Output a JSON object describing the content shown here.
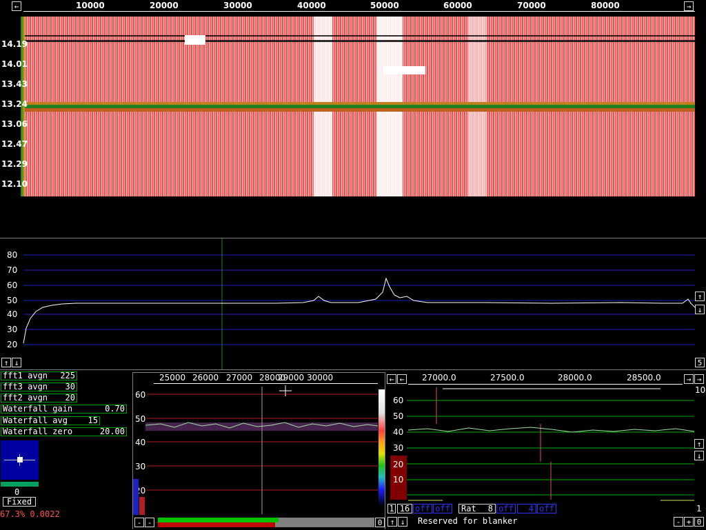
{
  "waterfall": {
    "freq_ticks": [
      "10000",
      "20000",
      "30000",
      "40000",
      "50000",
      "60000",
      "70000",
      "80000"
    ],
    "time_labels": [
      "14.19",
      "14.01",
      "13.43",
      "13.24",
      "13.06",
      "12.47",
      "12.29",
      "12.10"
    ]
  },
  "spectrum": {
    "y_ticks": [
      "80",
      "70",
      "60",
      "50",
      "40",
      "30",
      "20"
    ],
    "right_label": "5"
  },
  "params": [
    {
      "name": "fft1 avgn",
      "value": "225"
    },
    {
      "name": "fft3 avgn",
      "value": "30"
    },
    {
      "name": "fft2 avgn",
      "value": "20"
    },
    {
      "name": "Waterfall gain",
      "value": "0.70"
    },
    {
      "name": "Waterfall avg",
      "value": "15"
    },
    {
      "name": "Waterfall zero",
      "value": "20.00"
    }
  ],
  "smeter": {
    "value": "0",
    "mode": "Fixed",
    "status": "67.3% 0.0022",
    "status_color": "#ff5050"
  },
  "bg_window": {
    "freq_ticks": [
      "25000",
      "26000",
      "27000",
      "28000",
      "29000",
      "30000"
    ],
    "y_ticks": [
      "60",
      "50",
      "40",
      "30",
      "20"
    ],
    "right_button": "0"
  },
  "hires": {
    "freq_ticks": [
      "27000.0",
      "27500.0",
      "28000.0",
      "28500.0"
    ],
    "y_ticks": [
      "60",
      "50",
      "40",
      "30",
      "20",
      "10"
    ],
    "top_right_label": "10",
    "bottom_right_label": "1",
    "controls": {
      "b1": "1",
      "b2": "16",
      "off1": "off",
      "off2": "off",
      "rat_label": "Rat",
      "rat_value": "8",
      "off3": "off",
      "b4": "4",
      "off4": "off"
    },
    "blanker_text": "Reserved for blanker"
  },
  "buttons": {
    "left": "←",
    "right": "→",
    "up": "↑",
    "down": "↓",
    "minus": "-",
    "plus": "+",
    "zero": "0"
  },
  "colors": {
    "grid_blue": "#2020c0",
    "grid_green": "#00b000",
    "grid_red": "#b02020",
    "waterfall_base": "#ff5050"
  }
}
